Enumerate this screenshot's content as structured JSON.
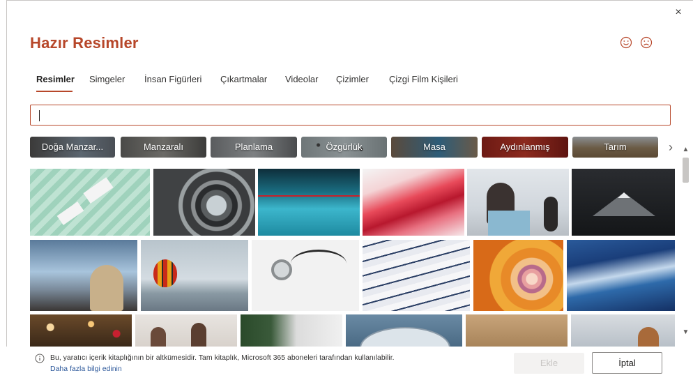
{
  "dialog": {
    "title": "Hazır Resimler",
    "close_label": "×",
    "feedback": {
      "happy_icon": "smiley-face-icon",
      "sad_icon": "frown-face-icon"
    }
  },
  "tabs": [
    {
      "label": "Resimler",
      "active": true
    },
    {
      "label": "Simgeler",
      "active": false
    },
    {
      "label": "İnsan Figürleri",
      "active": false
    },
    {
      "label": "Çıkartmalar",
      "active": false
    },
    {
      "label": "Videolar",
      "active": false
    },
    {
      "label": "Çizimler",
      "active": false
    },
    {
      "label": "Çizgi Film Kişileri",
      "active": false
    }
  ],
  "search": {
    "value": "",
    "placeholder": ""
  },
  "categories": [
    {
      "label": "Doğa Manzar..."
    },
    {
      "label": "Manzaralı"
    },
    {
      "label": "Planlama"
    },
    {
      "label": "Özgürlük"
    },
    {
      "label": "Masa"
    },
    {
      "label": "Aydınlanmış"
    },
    {
      "label": "Tarım"
    }
  ],
  "images": [
    {
      "name": "image-office-desks-aerial"
    },
    {
      "name": "image-photographer-camera-lens"
    },
    {
      "name": "image-red-wire-water-drops"
    },
    {
      "name": "image-red-paper-curves"
    },
    {
      "name": "image-classroom-children"
    },
    {
      "name": "image-mountain-peak-night"
    },
    {
      "name": "image-car-window-woman"
    },
    {
      "name": "image-hot-air-balloon"
    },
    {
      "name": "image-stethoscope"
    },
    {
      "name": "image-abstract-blue-lines"
    },
    {
      "name": "image-nautilus-shell"
    },
    {
      "name": "image-blue-feather"
    },
    {
      "name": "image-bokeh-lights"
    },
    {
      "name": "image-office-team-whiteboard"
    },
    {
      "name": "image-woman-window-plants"
    },
    {
      "name": "image-stopwatch"
    },
    {
      "name": "image-cardboard-boxes"
    },
    {
      "name": "image-person-hat-sky"
    }
  ],
  "footer": {
    "info_text": "Bu, yaratıcı içerik kitaplığının bir altkümesidir. Tam kitaplık, Microsoft 365 aboneleri tarafından kullanılabilir.",
    "info_link": "Daha fazla bilgi edinin",
    "insert_label": "Ekle",
    "cancel_label": "İptal"
  },
  "colors": {
    "accent": "#b7472a",
    "link": "#2b579a"
  }
}
